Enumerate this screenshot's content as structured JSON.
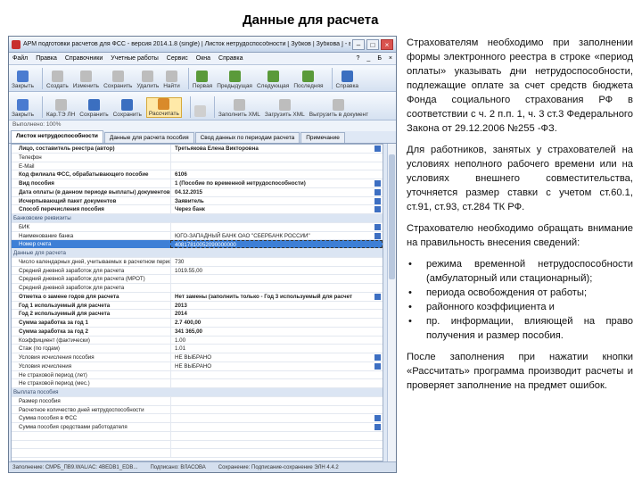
{
  "slide_title": "Данные для расчета",
  "window": {
    "title": "АРМ подготовки расчетов для ФСС - версия 2014.1.8 (single) | Листок нетрудоспособности [ Зубков | Зубкова ] - версия ...",
    "controls": [
      "–",
      "□",
      "×"
    ]
  },
  "menu": [
    "Файл",
    "Правка",
    "Справочники",
    "Учетные работы",
    "Сервис",
    "Окна",
    "Справка",
    "?",
    "_",
    "Б",
    "×"
  ],
  "toolbar1": [
    {
      "label": "Закрыть",
      "color": "#4a7bd0"
    },
    {
      "label": "Создать",
      "color": "#bdbdbd"
    },
    {
      "label": "Изменить",
      "color": "#bdbdbd"
    },
    {
      "label": "Сохранить",
      "color": "#bdbdbd"
    },
    {
      "label": "Удалить",
      "color": "#bdbdbd"
    },
    {
      "label": "Найти",
      "color": "#bdbdbd"
    },
    {
      "label": "Первая",
      "color": "#5a9a3a"
    },
    {
      "label": "Предыдущая",
      "color": "#5a9a3a"
    },
    {
      "label": "Следующая",
      "color": "#5a9a3a"
    },
    {
      "label": "Последняя",
      "color": "#5a9a3a"
    },
    {
      "label": "Справка",
      "color": "#3b6fc0"
    }
  ],
  "toolbar2": [
    {
      "label": "Закрыть",
      "color": "#4a7bd0"
    },
    {
      "label": "Кар.ТЭ ЛН",
      "color": "#bdbdbd"
    },
    {
      "label": "Сохранить",
      "color": "#3b6fc0"
    },
    {
      "label": "Сохранить",
      "color": "#3b6fc0"
    },
    {
      "label": "Рассчитать",
      "color": "#d98a2a",
      "selected": true
    },
    {
      "label": "",
      "color": "#cfcfcf"
    },
    {
      "label": "Заполнить XML",
      "color": "#bdbdbd"
    },
    {
      "label": "Загрузить XML",
      "color": "#bdbdbd"
    },
    {
      "label": "Выгрузить в документ",
      "color": "#bdbdbd"
    }
  ],
  "task_label": "Выполнено: 100%",
  "tabs": [
    {
      "label": "Листок нетрудоспособности",
      "active": true
    },
    {
      "label": "Данные для расчета пособия",
      "active": false
    },
    {
      "label": "Свод данных по периодам расчета",
      "active": false
    },
    {
      "label": "Примечание",
      "active": false
    }
  ],
  "grid_rows": [
    {
      "label": "Лицо, составитель реестра (автор)",
      "value": "Третьякова Елена Викторовна",
      "bold": true,
      "dd": true
    },
    {
      "label": "Телефон",
      "value": ""
    },
    {
      "label": "E-Mail",
      "value": ""
    },
    {
      "label": "Код филиала ФСС, обрабатывающего пособие",
      "value": "6106",
      "bold": true
    },
    {
      "label": "Вид пособия",
      "value": "1 (Пособие по временной нетрудоспособности)",
      "bold": true,
      "dd": true
    },
    {
      "label": "Дата оплаты (в данном периоде выплаты) документов",
      "value": "04.12.2015",
      "bold": true,
      "dd": true
    },
    {
      "label": "Исчерпывающий пакет документов",
      "value": "Заявитель",
      "bold": true,
      "dd": true
    },
    {
      "label": "Способ перечисления пособия",
      "value": "Через банк",
      "bold": true,
      "dd": true
    },
    {
      "label": "Банковские реквизиты",
      "value": "",
      "group": true
    },
    {
      "label": "БИК",
      "value": "",
      "dd": true
    },
    {
      "label": "Наименование банка",
      "value": "ЮГО-ЗАПАДНЫЙ БАНК ОАО \"СБЕРБАНК РОССИИ\"",
      "dd": true
    },
    {
      "label": "Номер счета",
      "value": "40817810052090000000",
      "sel": true,
      "hl": true
    },
    {
      "label": "Данные для расчета",
      "value": "",
      "group": true
    },
    {
      "label": "Число календарных дней, учитываемых в расчетном периоде",
      "value": "730"
    },
    {
      "label": "Средний дневной заработок для расчета",
      "value": "1019.55,00"
    },
    {
      "label": "Средний дневной заработок для расчета (МРОТ)",
      "value": ""
    },
    {
      "label": "Средний дневной заработок для расчета",
      "value": ""
    },
    {
      "label": "Отметка о замене годов для расчета",
      "value": "Нет замены (заполнить только - Год 3 используемый для расчет",
      "bold": true,
      "dd": true
    },
    {
      "label": "Год 1 используемый для расчета",
      "value": "2013",
      "bold": true
    },
    {
      "label": "Год 2 используемый для расчета",
      "value": "2014",
      "bold": true
    },
    {
      "label": "Сумма заработка за год 1",
      "value": "2.7 400,00",
      "bold": true
    },
    {
      "label": "Сумма заработка за год 2",
      "value": "341 365,00",
      "bold": true
    },
    {
      "label": "Коэффициент (фактически)",
      "value": "1.00"
    },
    {
      "label": "Стаж (по годам)",
      "value": "1.01"
    },
    {
      "label": "Условия исчисления пособия",
      "value": "НЕ ВЫБРАНО",
      "dd": true
    },
    {
      "label": "Условия исчисления",
      "value": "НЕ ВЫБРАНО",
      "dd": true
    },
    {
      "label": "Не страховой период (лет)",
      "value": ""
    },
    {
      "label": "Не страховой период (мес.)",
      "value": ""
    },
    {
      "label": "Выплата пособия",
      "value": "",
      "group": true
    },
    {
      "label": "Размер пособия",
      "value": ""
    },
    {
      "label": "Расчетное количество дней нетрудоспособности",
      "value": ""
    },
    {
      "label": "Сумма пособия в ФСС",
      "value": "",
      "dd": true
    },
    {
      "label": "Сумма пособия средствами работодателя",
      "value": "",
      "dd": true
    },
    {
      "label": "",
      "value": ""
    },
    {
      "label": "",
      "value": ""
    },
    {
      "label": "",
      "value": ""
    }
  ],
  "statusbar": [
    "Заполнение: СМРБ_ПВ9.WAL/АС: 4BEDB1_EDB...",
    "Подписано: ВЛАСОВА",
    "Сохранение: Подписание-сохранение ЭЛН 4.4.2"
  ],
  "text_paragraphs": [
    "Страхователям необходимо при заполнении формы электронного реестра в строке «период оплаты» указывать дни нетрудоспособности, подлежащие оплате за счет средств бюджета Фонда социального страхования РФ в соответствии с ч. 2 п.п. 1, ч. 3 ст.3 Федерального Закона от 29.12.2006 №255 -ФЗ.",
    "Для работников, занятых у страхователей на условиях неполного рабочего времени или на условиях внешнего совместительства, уточняется размер ставки с учетом ст.60.1, ст.91, ст.93, ст.284 ТК РФ.",
    "Страхователю необходимо обращать внимание на правильность внесения сведений:"
  ],
  "text_bullets": [
    "режима временной нетрудоспособности (амбулаторный или стационарный);",
    "периода освобождения от работы;",
    "районного коэффициента и",
    "пр. информации, влияющей на право получения и размер пособия."
  ],
  "text_after": "После заполнения при нажатии кнопки «Рассчитать» программа производит расчеты и проверяет заполнение на предмет ошибок."
}
